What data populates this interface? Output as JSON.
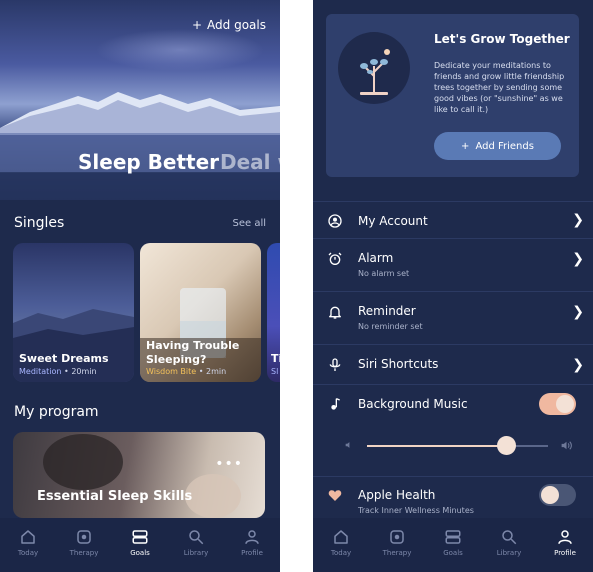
{
  "colors": {
    "background": "#1e2a4c",
    "accent_toggle": "#f0b8a0",
    "toggle_off": "#4a5675",
    "button": "#5a7ab5"
  },
  "left": {
    "add_goals": "Add goals",
    "hero_title": "Sleep Better",
    "hero_title_next": "Deal w",
    "singles_title": "Singles",
    "see_all": "See all",
    "singles": [
      {
        "title": "Sweet Dreams",
        "category": "Meditation",
        "duration": "20min",
        "category_color": "#a9b6ff"
      },
      {
        "title": "Having Trouble Sleeping?",
        "category": "Wisdom Bite",
        "duration": "2min",
        "category_color": "#f3c15a"
      },
      {
        "title": "Ti",
        "category": "Sl",
        "duration": "",
        "category_color": "#a9b6ff"
      }
    ],
    "program_title": "My program",
    "program_card_title": "Essential Sleep Skills",
    "tabs": [
      {
        "label": "Today",
        "icon": "house-icon",
        "active": false
      },
      {
        "label": "Therapy",
        "icon": "therapy-icon",
        "active": false
      },
      {
        "label": "Goals",
        "icon": "goals-icon",
        "active": true
      },
      {
        "label": "Library",
        "icon": "search-icon",
        "active": false
      },
      {
        "label": "Profile",
        "icon": "person-icon",
        "active": false
      }
    ]
  },
  "right": {
    "invite_title": "Let's Grow Together",
    "invite_body": "Dedicate your meditations to friends and grow little friendship trees together by sending some good vibes (or \"sunshine\" as we like to call it.)",
    "add_friends": "Add Friends",
    "settings": [
      {
        "label": "My Account",
        "sub": "",
        "icon": "account-icon",
        "control": "chevron"
      },
      {
        "label": "Alarm",
        "sub": "No alarm set",
        "icon": "alarm-icon",
        "control": "chevron"
      },
      {
        "label": "Reminder",
        "sub": "No reminder set",
        "icon": "bell-icon",
        "control": "chevron"
      },
      {
        "label": "Siri Shortcuts",
        "sub": "",
        "icon": "microphone-icon",
        "control": "chevron"
      },
      {
        "label": "Background Music",
        "sub": "",
        "icon": "music-note-icon",
        "control": "toggle",
        "on": true
      },
      {
        "label": "Apple Health",
        "sub": "Track Inner Wellness Minutes",
        "icon": "heart-icon",
        "control": "toggle",
        "on": false
      }
    ],
    "volume_level": 0.77,
    "tabs": [
      {
        "label": "Today",
        "icon": "house-icon",
        "active": false
      },
      {
        "label": "Therapy",
        "icon": "therapy-icon",
        "active": false
      },
      {
        "label": "Goals",
        "icon": "goals-icon",
        "active": false
      },
      {
        "label": "Library",
        "icon": "search-icon",
        "active": false
      },
      {
        "label": "Profile",
        "icon": "person-icon",
        "active": true
      }
    ]
  }
}
